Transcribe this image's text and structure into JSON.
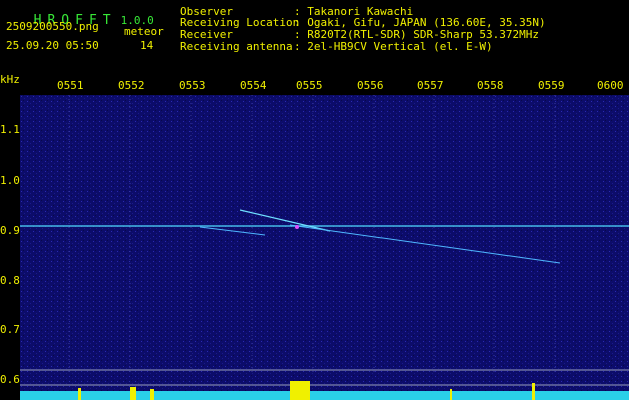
{
  "app": {
    "title": "HROFFT",
    "version": "1.0.0"
  },
  "file": {
    "name": "2509200550.png",
    "datetime": "25.09.20 05:50"
  },
  "meteor": {
    "label": "meteor",
    "count": "14"
  },
  "info": [
    {
      "key": "Observer",
      "value": ": Takanori Kawachi"
    },
    {
      "key": "Receiving Location",
      "value": ": Ogaki, Gifu, JAPAN (136.60E, 35.35N)"
    },
    {
      "key": "Receiver",
      "value": ": R820T2(RTL-SDR) SDR-Sharp 53.372MHz"
    },
    {
      "key": "Receiving antenna",
      "value": ": 2el-HB9CV Vertical (el. E-W)"
    }
  ],
  "axis": {
    "unit_label": "kHz",
    "time_ticks": [
      "0551",
      "0552",
      "0553",
      "0554",
      "0555",
      "0556",
      "0557",
      "0558",
      "0559",
      "0600"
    ],
    "freq_ticks": [
      "1.1",
      "1.0",
      "0.9",
      "0.8",
      "0.7",
      "0.6"
    ]
  },
  "colors": {
    "background": "#000000",
    "spectrum": "#0c0c6a",
    "text_yellow": "#f0f000",
    "text_green": "#37e837",
    "trace": "#4fd8ff"
  }
}
